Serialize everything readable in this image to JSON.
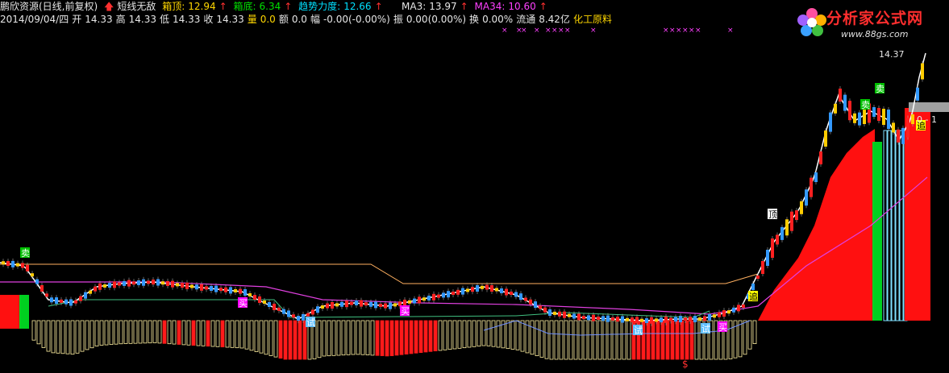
{
  "header": {
    "stock": "鹏欣资源(日线,前复权)",
    "indicator_name": "短线无敌",
    "box_top_label": "箱顶:",
    "box_top_value": "12.94",
    "box_bottom_label": "箱底:",
    "box_bottom_value": "6.34",
    "trend_label": "趋势力度:",
    "trend_value": "12.66",
    "ma3_label": "MA3:",
    "ma3_value": "13.97",
    "ma34_label": "MA34:",
    "ma34_value": "10.60"
  },
  "info": {
    "date": "2014/09/04/四",
    "open_label": "开",
    "open": "14.33",
    "high_label": "高",
    "high": "14.33",
    "low_label": "低",
    "low": "14.33",
    "close_label": "收",
    "close": "14.33",
    "vol_label": "量",
    "vol": "0.0",
    "amt_label": "额",
    "amt": "0.0",
    "chg_label": "幅",
    "chg": "-0.00(-0.00%)",
    "amp_label": "振",
    "amp": "0.00(0.00%)",
    "turn_label": "换",
    "turn": "0.00%",
    "float_label": "流通",
    "float": "8.42亿",
    "sector": "化工原料"
  },
  "logo": {
    "brand": "分析家公式网",
    "url": "www.88gs.com"
  },
  "colors": {
    "background": "#000000",
    "up_candle": "#ff2020",
    "down_candle": "#3399ff",
    "yellow_candle": "#ffcc00",
    "white_line": "#ffffff",
    "ma34": "#e040e0",
    "box_line": "#ffb060",
    "green_bar": "#00d020"
  },
  "chart_data": {
    "type": "candlestick",
    "price_label": "14.37",
    "right_label": "0 - 1",
    "signal_labels": {
      "sell": "卖",
      "buy": "买",
      "try": "试",
      "top": "顶",
      "chase": "追",
      "dollar": "$"
    },
    "series": [
      {
        "name": "MA3",
        "value": 13.97
      },
      {
        "name": "MA34",
        "value": 10.6
      }
    ],
    "box_top": 12.94,
    "box_bottom": 6.34
  }
}
